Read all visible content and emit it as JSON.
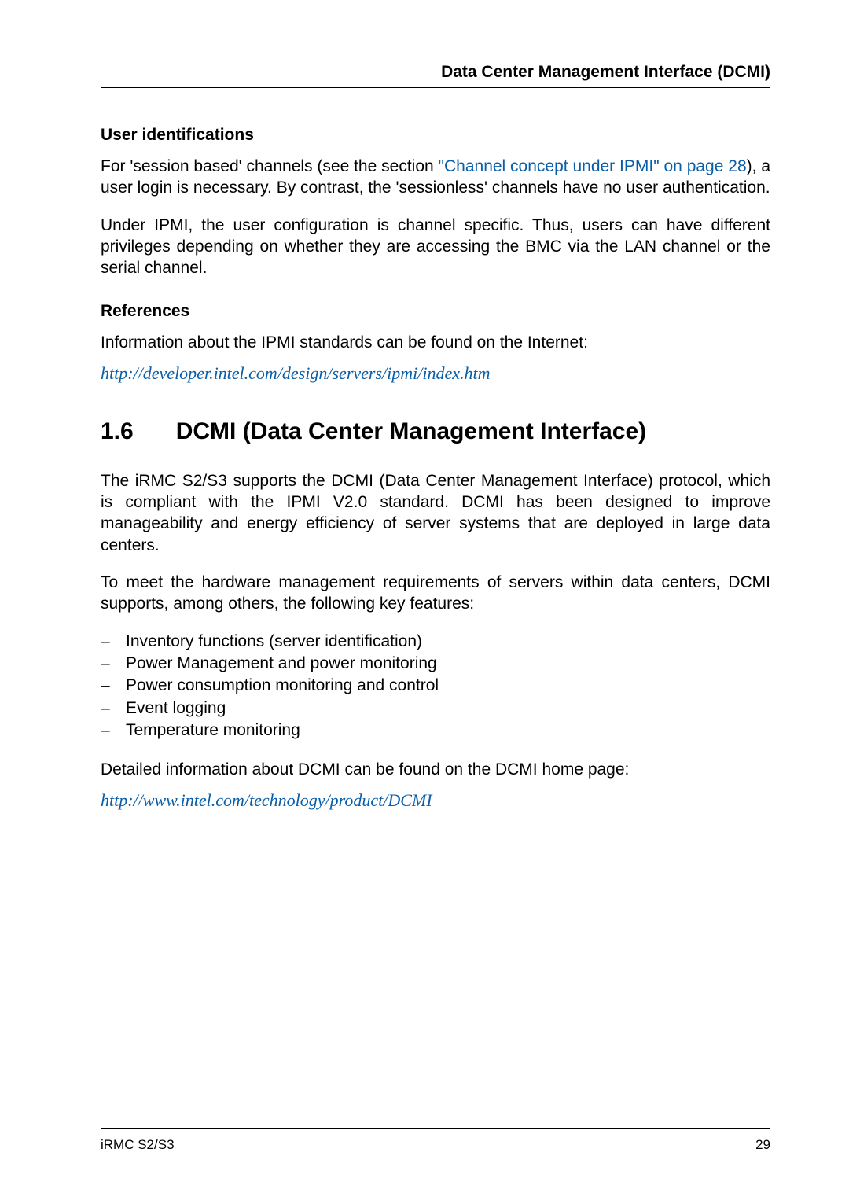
{
  "header": {
    "running_head": "Data Center Management Interface (DCMI)"
  },
  "user_identifications": {
    "heading": "User identifications",
    "para1_pre": "For 'session based' channels (see the section ",
    "para1_link": "\"Channel concept under IPMI\" on page 28",
    "para1_post": "), a user login is necessary. By contrast, the 'sessionless' channels have no user authentication.",
    "para2": "Under IPMI, the user configuration is channel specific. Thus, users can have different privileges depending on whether they are accessing the BMC via the LAN channel or the serial channel."
  },
  "references": {
    "heading": "References",
    "intro": "Information about the IPMI standards can be found on the Internet:",
    "url": "http://developer.intel.com/design/servers/ipmi/index.htm"
  },
  "section": {
    "number": "1.6",
    "title": "DCMI (Data Center Management Interface)",
    "para1": "The iRMC S2/S3 supports the DCMI (Data Center Management Interface) protocol, which is compliant with the IPMI V2.0 standard. DCMI has been designed to improve manageability and energy efficiency of server systems that are deployed in large data centers.",
    "para2": "To meet the hardware management requirements of servers within data centers, DCMI supports, among others, the following key features:",
    "features": [
      "Inventory functions (server identification)",
      "Power Management and power monitoring",
      "Power consumption monitoring and control",
      "Event logging",
      "Temperature monitoring"
    ],
    "para3": "Detailed information about DCMI can be found on the DCMI home page:",
    "url": "http://www.intel.com/technology/product/DCMI"
  },
  "footer": {
    "left": "iRMC S2/S3",
    "right": "29"
  }
}
